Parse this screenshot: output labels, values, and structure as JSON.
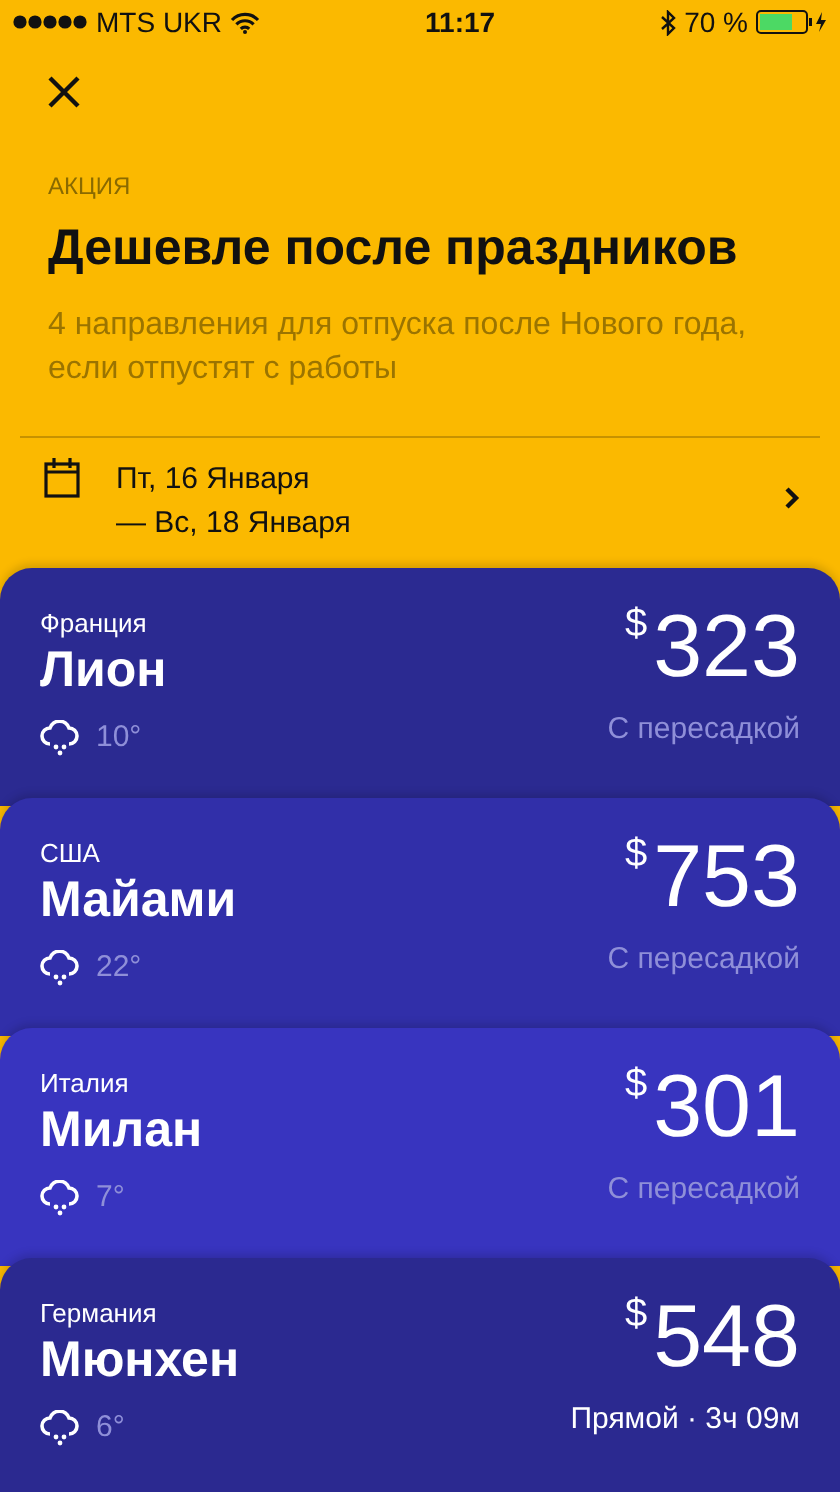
{
  "status_bar": {
    "carrier": "MTS UKR",
    "time": "11:17",
    "battery": "70 %"
  },
  "promo": {
    "eyebrow": "АКЦИЯ",
    "title": "Дешевле после праздников",
    "description": "4 направления для отпуска после Нового года, если отпустят с работы"
  },
  "dates": {
    "from": "Пт, 16 Января",
    "to": "— Вс, 18 Января"
  },
  "destinations": [
    {
      "country": "Франция",
      "city": "Лион",
      "temperature": "10°",
      "currency": "$",
      "price": "323",
      "route": "С пересадкой",
      "direct": false,
      "color": "#2b2a91"
    },
    {
      "country": "США",
      "city": "Майами",
      "temperature": "22°",
      "currency": "$",
      "price": "753",
      "route": "С пересадкой",
      "direct": false,
      "color": "#312fa9"
    },
    {
      "country": "Италия",
      "city": "Милан",
      "temperature": "7°",
      "currency": "$",
      "price": "301",
      "route": "С пересадкой",
      "direct": false,
      "color": "#3834bf"
    },
    {
      "country": "Германия",
      "city": "Мюнхен",
      "temperature": "6°",
      "currency": "$",
      "price": "548",
      "route": "Прямой · 3ч 09м",
      "direct": true,
      "color": "#2b2990"
    }
  ]
}
